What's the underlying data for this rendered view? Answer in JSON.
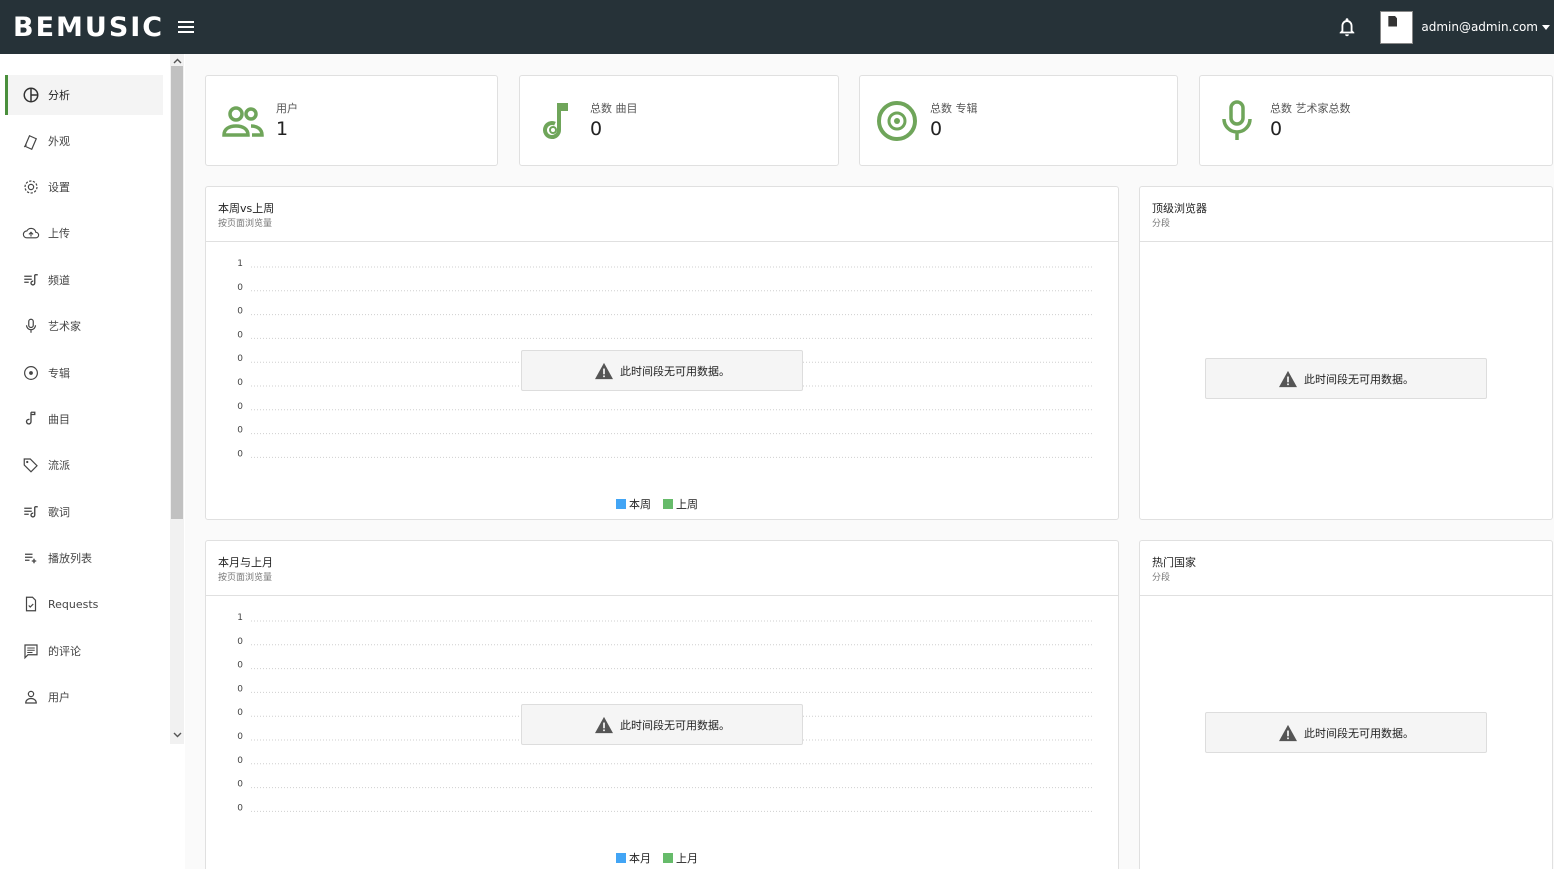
{
  "app": {
    "logo": "BEMUSIC"
  },
  "topbar": {
    "user_email": "admin@admin.com"
  },
  "sidebar": {
    "items": [
      {
        "label": "分析",
        "icon": "analytics-icon"
      },
      {
        "label": "外观",
        "icon": "appearance-icon"
      },
      {
        "label": "设置",
        "icon": "gear-icon"
      },
      {
        "label": "上传",
        "icon": "cloud-upload-icon"
      },
      {
        "label": "频道",
        "icon": "queue-music-icon"
      },
      {
        "label": "艺术家",
        "icon": "mic-icon"
      },
      {
        "label": "专辑",
        "icon": "album-icon"
      },
      {
        "label": "曲目",
        "icon": "music-note-icon"
      },
      {
        "label": "流派",
        "icon": "tag-icon"
      },
      {
        "label": "歌词",
        "icon": "lyrics-icon"
      },
      {
        "label": "播放列表",
        "icon": "playlist-icon"
      },
      {
        "label": "Requests",
        "icon": "request-icon"
      },
      {
        "label": "的评论",
        "icon": "comment-icon"
      },
      {
        "label": "用户",
        "icon": "person-icon"
      }
    ]
  },
  "stats": [
    {
      "label": "用户",
      "value": "1",
      "icon": "users-icon"
    },
    {
      "label": "总数 曲目",
      "value": "0",
      "icon": "music-note-icon"
    },
    {
      "label": "总数 专辑",
      "value": "0",
      "icon": "album-icon"
    },
    {
      "label": "总数 艺术家总数",
      "value": "0",
      "icon": "mic-icon"
    }
  ],
  "panels": {
    "week": {
      "title": "本周vs上周",
      "subtitle": "按页面浏览量",
      "nodata": "此时间段无可用数据。",
      "legend": [
        "本周",
        "上周"
      ]
    },
    "browsers": {
      "title": "顶级浏览器",
      "subtitle": "分段",
      "nodata": "此时间段无可用数据。"
    },
    "month": {
      "title": "本月与上月",
      "subtitle": "按页面浏览量",
      "nodata": "此时间段无可用数据。",
      "legend": [
        "本月",
        "上月"
      ]
    },
    "countries": {
      "title": "热门国家",
      "subtitle": "分段",
      "nodata": "此时间段无可用数据。"
    }
  },
  "colors": {
    "accent": "#6fa55a",
    "series_current": "#42a5f5",
    "series_previous": "#66bb6a",
    "topbar": "#263238"
  },
  "chart_data": [
    {
      "type": "line",
      "title": "本周vs上周",
      "subtitle": "按页面浏览量",
      "y_tick_labels": [
        "1",
        "0",
        "0",
        "0",
        "0",
        "0",
        "0",
        "0",
        "0"
      ],
      "series": [
        {
          "name": "本周",
          "values": []
        },
        {
          "name": "上周",
          "values": []
        }
      ],
      "grid": true,
      "legend": "bottom"
    },
    {
      "type": "line",
      "title": "本月与上月",
      "subtitle": "按页面浏览量",
      "y_tick_labels": [
        "1",
        "0",
        "0",
        "0",
        "0",
        "0",
        "0",
        "0",
        "0"
      ],
      "series": [
        {
          "name": "本月",
          "values": []
        },
        {
          "name": "上月",
          "values": []
        }
      ],
      "grid": true,
      "legend": "bottom"
    }
  ]
}
